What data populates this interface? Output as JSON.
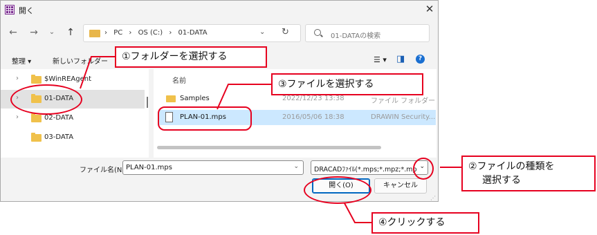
{
  "window": {
    "title": "開く",
    "close_glyph": "✕"
  },
  "nav": {
    "back": "←",
    "forward": "→",
    "up_dropdown": "⌄",
    "up": "↑"
  },
  "address": {
    "crumbs": [
      "›",
      "PC",
      "›",
      "OS (C:)",
      "›",
      "01-DATA"
    ],
    "chevron": "⌄",
    "refresh": "↻"
  },
  "search": {
    "placeholder": "01-DATAの検索"
  },
  "toolbar": {
    "organize": "整理 ▾",
    "new_folder": "新しいフォルダー",
    "view_icon": "☰ ▾",
    "pane_icon": "◨",
    "help_icon": "?"
  },
  "sidebar": {
    "items": [
      {
        "label": "$WinREAgent",
        "chevron": "›"
      },
      {
        "label": "01-DATA",
        "chevron": "›",
        "selected": true
      },
      {
        "label": "02-DATA",
        "chevron": "›"
      },
      {
        "label": "03-DATA",
        "chevron": ""
      }
    ]
  },
  "files": {
    "column_name": "名前",
    "rows": [
      {
        "name": "Samples",
        "date": "2022/12/23 13:38",
        "type": "ファイル フォルダー",
        "kind": "folder"
      },
      {
        "name": "PLAN-01.mps",
        "date": "2016/05/06 18:38",
        "type": "DRAWIN Security...",
        "kind": "file",
        "selected": true
      }
    ]
  },
  "bottom": {
    "filename_label": "ファイル名(N):",
    "filename_value": "PLAN-01.mps",
    "filename_dropdown": "⌄",
    "filetype_value": "DRACADﾌｧｲﾙ(*.mps;*.mpz;*.mp",
    "filetype_dropdown": "⌄",
    "open_button": "開く(O)",
    "cancel_button": "キャンセル",
    "resize_grip": "⋰"
  },
  "callouts": {
    "step1": "①フォルダーを選択する",
    "step2_line1": "②ファイルの種類を",
    "step2_line2": "選択する",
    "step3": "③ファイルを選択する",
    "step4": "④クリックする"
  },
  "colors": {
    "accent": "#e6001f",
    "selection": "#cce8ff",
    "folder": "#f0c14b"
  }
}
